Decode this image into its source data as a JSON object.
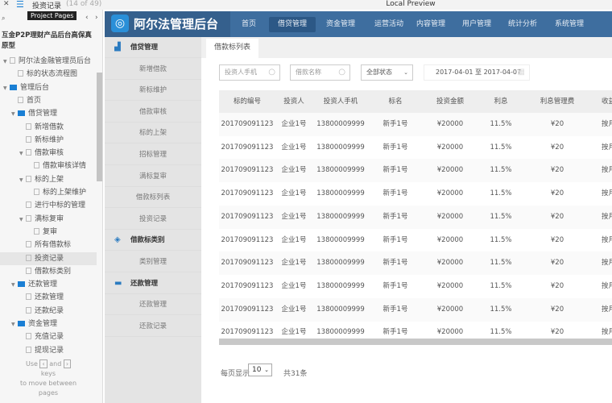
{
  "window": {
    "title": "Local Preview",
    "page_name": "投资记录",
    "page_count": "(14 of 49)",
    "tooltip": "Project Pages"
  },
  "project": {
    "title": "互金P2P理财产品后台高保真原型",
    "tree": [
      {
        "label": "阿尔法金融管理员后台",
        "level": 0,
        "type": "page",
        "expanded": true
      },
      {
        "label": "标的状态流程图",
        "level": 1,
        "type": "page"
      },
      {
        "label": "管理后台",
        "level": 0,
        "type": "folder",
        "expanded": true
      },
      {
        "label": "首页",
        "level": 1,
        "type": "page"
      },
      {
        "label": "借贷管理",
        "level": 1,
        "type": "folder",
        "expanded": true
      },
      {
        "label": "新增借款",
        "level": 2,
        "type": "page"
      },
      {
        "label": "新标维护",
        "level": 2,
        "type": "page"
      },
      {
        "label": "借款审核",
        "level": 2,
        "type": "page",
        "expanded": true
      },
      {
        "label": "借款审核详情",
        "level": 3,
        "type": "page"
      },
      {
        "label": "标的上架",
        "level": 2,
        "type": "page",
        "expanded": true
      },
      {
        "label": "标的上架维护",
        "level": 3,
        "type": "page"
      },
      {
        "label": "进行中标的管理",
        "level": 2,
        "type": "page"
      },
      {
        "label": "满标复审",
        "level": 2,
        "type": "page",
        "expanded": true
      },
      {
        "label": "复审",
        "level": 3,
        "type": "page"
      },
      {
        "label": "所有借款标",
        "level": 2,
        "type": "page"
      },
      {
        "label": "投资记录",
        "level": 2,
        "type": "page",
        "selected": true
      },
      {
        "label": "借款标类别",
        "level": 2,
        "type": "page"
      },
      {
        "label": "还款管理",
        "level": 1,
        "type": "folder",
        "expanded": true
      },
      {
        "label": "还款管理",
        "level": 2,
        "type": "page"
      },
      {
        "label": "还款纪录",
        "level": 2,
        "type": "page"
      },
      {
        "label": "资金管理",
        "level": 1,
        "type": "folder",
        "expanded": true
      },
      {
        "label": "充值记录",
        "level": 2,
        "type": "page"
      },
      {
        "label": "提现记录",
        "level": 2,
        "type": "page"
      }
    ],
    "hint_use": "Use",
    "hint_and": "and",
    "hint_keys": "keys",
    "hint_move": "to move between",
    "hint_pages": "pages"
  },
  "app": {
    "logo": "阿尔法管理后台",
    "nav": [
      "首页",
      "借贷管理",
      "资金管理",
      "运营活动",
      "内容管理",
      "用户管理",
      "统计分析",
      "系统管理"
    ],
    "nav_active": 1,
    "sidebar": [
      {
        "label": "借贷管理",
        "header": true,
        "icon": "chart-icon"
      },
      {
        "label": "新增借款"
      },
      {
        "label": "新标维护"
      },
      {
        "label": "借款审核"
      },
      {
        "label": "标的上架"
      },
      {
        "label": "招标管理"
      },
      {
        "label": "满标复审"
      },
      {
        "label": "借款标列表"
      },
      {
        "label": "投资记录"
      },
      {
        "label": "借款标类别",
        "header": true,
        "icon": "cube-icon"
      },
      {
        "label": "类别管理"
      },
      {
        "label": "还款管理",
        "header": true,
        "icon": "card-icon"
      },
      {
        "label": "还款管理"
      },
      {
        "label": "还款记录"
      }
    ],
    "tab": "借款标列表",
    "filters": {
      "phone_placeholder": "投资人手机",
      "name_placeholder": "借款名称",
      "status": "全部状态",
      "date_range": "2017-04-01 至 2017-04-07"
    },
    "table": {
      "headers": [
        "标的编号",
        "投资人",
        "投资人手机",
        "标名",
        "投资金额",
        "利息",
        "利息管理费",
        "收益方式"
      ],
      "rows": [
        [
          "201709091123",
          "企业1号",
          "13800009999",
          "新手1号",
          "¥20000",
          "11.5%",
          "¥20",
          "按月付息"
        ],
        [
          "201709091123",
          "企业1号",
          "13800009999",
          "新手1号",
          "¥20000",
          "11.5%",
          "¥20",
          "按月付息"
        ],
        [
          "201709091123",
          "企业1号",
          "13800009999",
          "新手1号",
          "¥20000",
          "11.5%",
          "¥20",
          "按月付息"
        ],
        [
          "201709091123",
          "企业1号",
          "13800009999",
          "新手1号",
          "¥20000",
          "11.5%",
          "¥20",
          "按月付息"
        ],
        [
          "201709091123",
          "企业1号",
          "13800009999",
          "新手1号",
          "¥20000",
          "11.5%",
          "¥20",
          "按月付息"
        ],
        [
          "201709091123",
          "企业1号",
          "13800009999",
          "新手1号",
          "¥20000",
          "11.5%",
          "¥20",
          "按月付息"
        ],
        [
          "201709091123",
          "企业1号",
          "13800009999",
          "新手1号",
          "¥20000",
          "11.5%",
          "¥20",
          "按月付息"
        ],
        [
          "201709091123",
          "企业1号",
          "13800009999",
          "新手1号",
          "¥20000",
          "11.5%",
          "¥20",
          "按月付息"
        ],
        [
          "201709091123",
          "企业1号",
          "13800009999",
          "新手1号",
          "¥20000",
          "11.5%",
          "¥20",
          "按月付息"
        ],
        [
          "201709091123",
          "企业1号",
          "13800009999",
          "新手1号",
          "¥20000",
          "11.5%",
          "¥20",
          "按月付息"
        ]
      ]
    },
    "pagination": {
      "per_page_label": "每页显示",
      "per_page": "10",
      "total": "共31条"
    }
  }
}
